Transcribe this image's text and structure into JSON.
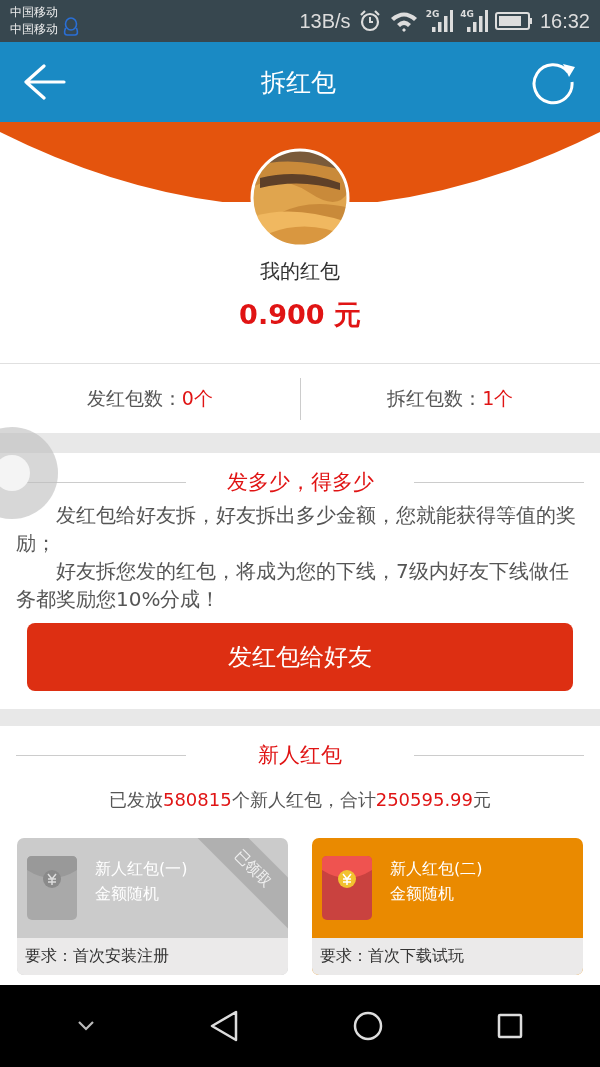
{
  "status_bar": {
    "carriers": [
      "中国移动",
      "中国移动"
    ],
    "net_speed": "13B/s",
    "signal_labels": [
      "2G",
      "4G"
    ],
    "time": "16:32"
  },
  "header": {
    "title": "拆红包"
  },
  "profile": {
    "name": "我的红包",
    "balance": "0.900 元"
  },
  "stats": [
    {
      "label": "发红包数：",
      "value": "0个"
    },
    {
      "label": "拆红包数：",
      "value": "1个"
    }
  ],
  "promo": {
    "title": "发多少，得多少",
    "paragraphs": [
      "发红包给好友拆，好友拆出多少金额，您就能获得等值的奖励；",
      "好友拆您发的红包，将成为您的下线，7级内好友下线做任务都奖励您10%分成！"
    ],
    "button": "发红包给好友"
  },
  "newcomer": {
    "title": "新人红包",
    "summary": [
      {
        "text": "已发放",
        "highlight": false
      },
      {
        "text": "580815",
        "highlight": true
      },
      {
        "text": "个新人红包，合计",
        "highlight": false
      },
      {
        "text": "250595.99",
        "highlight": true
      },
      {
        "text": "元",
        "highlight": false
      }
    ],
    "cards": [
      {
        "title": "新人红包(一)",
        "subtitle": "金额随机",
        "requirement": "要求：首次安装注册",
        "claimed": true,
        "stamp": "已领取"
      },
      {
        "title": "新人红包(二)",
        "subtitle": "金额随机",
        "requirement": "要求：首次下载试玩",
        "claimed": false
      }
    ]
  }
}
